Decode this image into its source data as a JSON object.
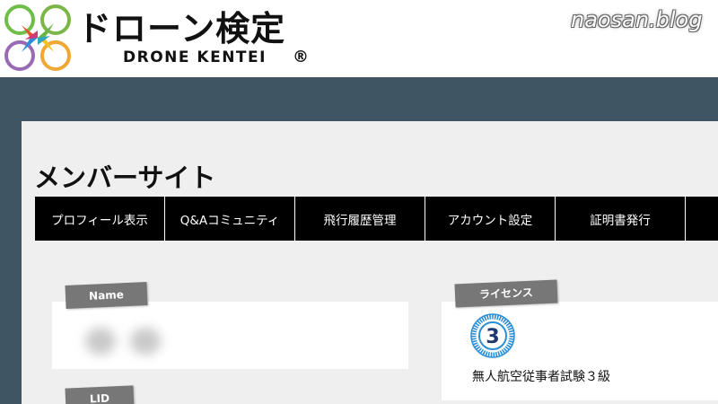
{
  "header": {
    "logo_title": "ドローン検定",
    "logo_subtitle": "DRONE KENTEI",
    "logo_reg_mark": "®",
    "watermark": "naosan.blog"
  },
  "page": {
    "title": "メンバーサイト"
  },
  "nav": {
    "items": [
      {
        "label": "プロフィール表示"
      },
      {
        "label": "Q&Aコミュニティ"
      },
      {
        "label": "飛行履歴管理"
      },
      {
        "label": "アカウント設定"
      },
      {
        "label": "証明書発行"
      }
    ]
  },
  "profile": {
    "name_label": "Name",
    "lid_label": "LID"
  },
  "license": {
    "label": "ライセンス",
    "badge_number": "3",
    "text": "無人航空従事者試験３級"
  },
  "colors": {
    "background": "#3f5564",
    "panel": "#efefef",
    "nav": "#000000",
    "tag": "#777777",
    "badge": "#2a8fd6"
  },
  "icons": {
    "logo": "drone-logo-icon",
    "badge": "license-badge-icon"
  }
}
